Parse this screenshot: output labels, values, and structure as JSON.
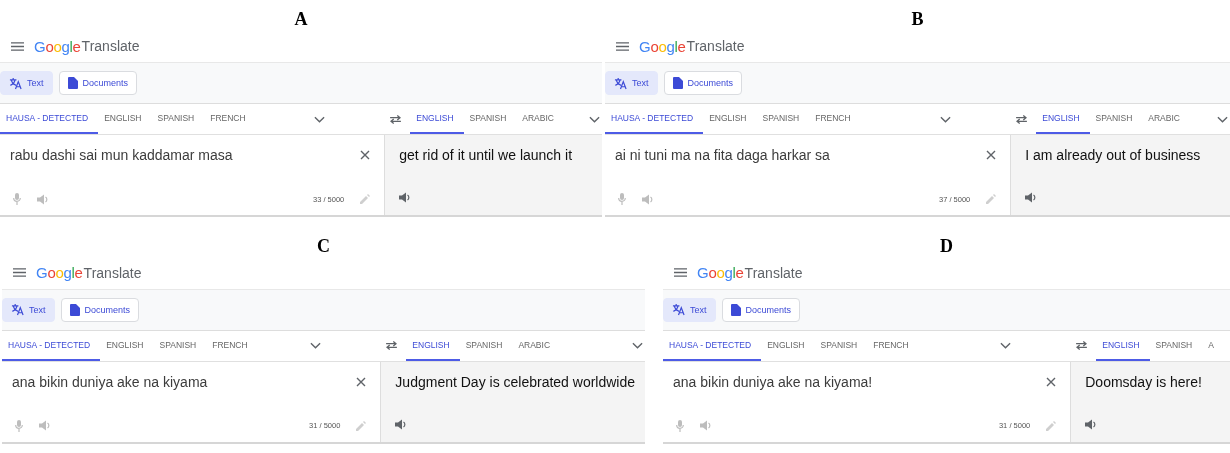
{
  "panels": [
    {
      "label": "A",
      "logo": {
        "brand": "Google",
        "product": "Translate"
      },
      "modes": [
        {
          "label": "Text",
          "selected": true
        },
        {
          "label": "Documents",
          "selected": false
        }
      ],
      "source_languages": [
        {
          "label": "HAUSA - DETECTED",
          "selected": true
        },
        {
          "label": "ENGLISH",
          "selected": false
        },
        {
          "label": "SPANISH",
          "selected": false
        },
        {
          "label": "FRENCH",
          "selected": false
        }
      ],
      "target_languages": [
        {
          "label": "ENGLISH",
          "selected": true
        },
        {
          "label": "SPANISH",
          "selected": false
        },
        {
          "label": "ARABIC",
          "selected": false
        }
      ],
      "target_menu": true,
      "source_text": "rabu dashi sai mun kaddamar masa",
      "char_count": "33 / 5000",
      "translation": "get rid of it until we launch it"
    },
    {
      "label": "B",
      "logo": {
        "brand": "Google",
        "product": "Translate"
      },
      "modes": [
        {
          "label": "Text",
          "selected": true
        },
        {
          "label": "Documents",
          "selected": false
        }
      ],
      "source_languages": [
        {
          "label": "HAUSA - DETECTED",
          "selected": true
        },
        {
          "label": "ENGLISH",
          "selected": false
        },
        {
          "label": "SPANISH",
          "selected": false
        },
        {
          "label": "FRENCH",
          "selected": false
        }
      ],
      "target_languages": [
        {
          "label": "ENGLISH",
          "selected": true
        },
        {
          "label": "SPANISH",
          "selected": false
        },
        {
          "label": "ARABIC",
          "selected": false
        }
      ],
      "target_menu": true,
      "source_text": "ai ni tuni ma na fita daga harkar sa",
      "char_count": "37 / 5000",
      "translation": "I am already out of business"
    },
    {
      "label": "C",
      "logo": {
        "brand": "Google",
        "product": "Translate"
      },
      "modes": [
        {
          "label": "Text",
          "selected": true
        },
        {
          "label": "Documents",
          "selected": false
        }
      ],
      "source_languages": [
        {
          "label": "HAUSA - DETECTED",
          "selected": true
        },
        {
          "label": "ENGLISH",
          "selected": false
        },
        {
          "label": "SPANISH",
          "selected": false
        },
        {
          "label": "FRENCH",
          "selected": false
        }
      ],
      "target_languages": [
        {
          "label": "ENGLISH",
          "selected": true
        },
        {
          "label": "SPANISH",
          "selected": false
        },
        {
          "label": "ARABIC",
          "selected": false
        }
      ],
      "target_menu": true,
      "source_text": "ana bikin duniya ake na kiyama",
      "char_count": "31 / 5000",
      "translation": "Judgment Day is celebrated worldwide"
    },
    {
      "label": "D",
      "logo": {
        "brand": "Google",
        "product": "Translate"
      },
      "modes": [
        {
          "label": "Text",
          "selected": true
        },
        {
          "label": "Documents",
          "selected": false
        }
      ],
      "source_languages": [
        {
          "label": "HAUSA - DETECTED",
          "selected": true
        },
        {
          "label": "ENGLISH",
          "selected": false
        },
        {
          "label": "SPANISH",
          "selected": false
        },
        {
          "label": "FRENCH",
          "selected": false
        }
      ],
      "target_languages": [
        {
          "label": "ENGLISH",
          "selected": true
        },
        {
          "label": "SPANISH",
          "selected": false
        },
        {
          "label": "A",
          "selected": false
        }
      ],
      "target_menu": false,
      "source_text": "ana bikin duniya ake na kiyama!",
      "char_count": "31 / 5000",
      "translation": "Doomsday is here!"
    }
  ]
}
